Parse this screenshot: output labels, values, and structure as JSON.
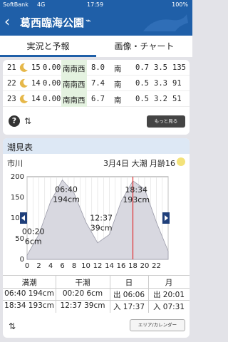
{
  "status": {
    "carrier": "SoftBank",
    "network": "4G",
    "time": "17:59",
    "battery": "100%"
  },
  "nav": {
    "title": "葛西臨海公園"
  },
  "tabs": [
    "実況と予報",
    "画像・チャート"
  ],
  "forecast_rows": [
    {
      "hour": "21",
      "temp": "15",
      "rain": "0.00",
      "wind_dir": "南南西",
      "wind_speed": "8.0",
      "wave_dir": "南",
      "wave_height": "0.7",
      "period": "3.5",
      "dir_deg": "135"
    },
    {
      "hour": "22",
      "temp": "14",
      "rain": "0.00",
      "wind_dir": "南南西",
      "wind_speed": "7.4",
      "wave_dir": "南",
      "wave_height": "0.5",
      "period": "3.3",
      "dir_deg": "91"
    },
    {
      "hour": "23",
      "temp": "14",
      "rain": "0.00",
      "wind_dir": "南南西",
      "wind_speed": "6.7",
      "wave_dir": "南",
      "wave_height": "0.5",
      "period": "3.2",
      "dir_deg": "51"
    }
  ],
  "more_label": "もっと見る",
  "tide": {
    "section_title": "潮見表",
    "location": "市川",
    "date_info": "3月4日 大潮 月齢16",
    "table_headers": [
      "満潮",
      "干潮",
      "日",
      "月"
    ],
    "table_rows": [
      [
        "06:40 194cm",
        "00:20 6cm",
        "出 06:06",
        "出 20:01"
      ],
      [
        "18:34 193cm",
        "12:37 39cm",
        "入 17:37",
        "入 07:31"
      ]
    ],
    "area_button": "エリア/カレンダー"
  },
  "chart_data": {
    "type": "area",
    "x": [
      0,
      2,
      4,
      6,
      8,
      10,
      12,
      14,
      16,
      18,
      20,
      22,
      24
    ],
    "values": [
      10,
      60,
      140,
      192,
      160,
      90,
      40,
      60,
      140,
      190,
      170,
      90,
      20
    ],
    "xticks": [
      "0",
      "2",
      "4",
      "6",
      "8",
      "10",
      "12",
      "14",
      "16",
      "18",
      "20",
      "22"
    ],
    "yticks": [
      "0",
      "50",
      "100",
      "150",
      "200"
    ],
    "ylim": [
      0,
      200
    ],
    "xlim": [
      0,
      24
    ],
    "annotations": [
      {
        "time": "06:40",
        "height": "194cm",
        "x": 6.67,
        "y": 194
      },
      {
        "time": "18:34",
        "height": "193cm",
        "x": 18.57,
        "y": 193
      },
      {
        "time": "00:20",
        "height": "6cm",
        "x": 0.33,
        "y": 6
      },
      {
        "time": "12:37",
        "height": "39cm",
        "x": 12.62,
        "y": 39
      }
    ],
    "now_marker": 18.0,
    "colors": {
      "fill": "#d8d8e0",
      "line": "#9a9aa8",
      "now": "#e03030"
    }
  }
}
